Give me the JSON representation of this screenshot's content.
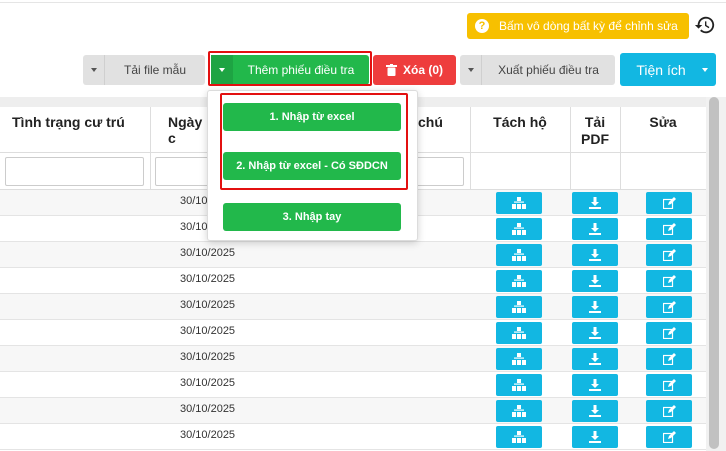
{
  "hint": {
    "text": "Bấm vô dòng bất kỳ để chỉnh sửa",
    "icon": "question-icon"
  },
  "history_icon": "history-icon",
  "toolbar": {
    "download_template_label": "Tải file mẫu",
    "add_survey_label": "Thêm phiếu điều tra",
    "delete_label": "Xóa (0)",
    "export_label": "Xuất phiếu điều tra",
    "utilities_label": "Tiện ích"
  },
  "add_menu": {
    "items": [
      {
        "label": "1. Nhập từ excel"
      },
      {
        "label": "2. Nhập từ excel - Có SĐDCN"
      },
      {
        "label": "3. Nhập tay"
      }
    ]
  },
  "table": {
    "columns": {
      "residence_status": "Tình trạng cư trú",
      "date": "Ngày c",
      "note": "chú",
      "split_household": "Tách hộ",
      "pdf_line1": "Tải",
      "pdf_line2": "PDF",
      "edit": "Sửa"
    },
    "rows": [
      {
        "date": "30/10"
      },
      {
        "date": "30/10"
      },
      {
        "date": "30/10/2025"
      },
      {
        "date": "30/10/2025"
      },
      {
        "date": "30/10/2025"
      },
      {
        "date": "30/10/2025"
      },
      {
        "date": "30/10/2025"
      },
      {
        "date": "30/10/2025"
      },
      {
        "date": "30/10/2025"
      },
      {
        "date": "30/10/2025"
      }
    ]
  },
  "colors": {
    "green": "#22b84b",
    "cyan": "#12b7e2",
    "red": "#ee3d3d",
    "yellow": "#f7c000",
    "highlight": "#e31010"
  }
}
